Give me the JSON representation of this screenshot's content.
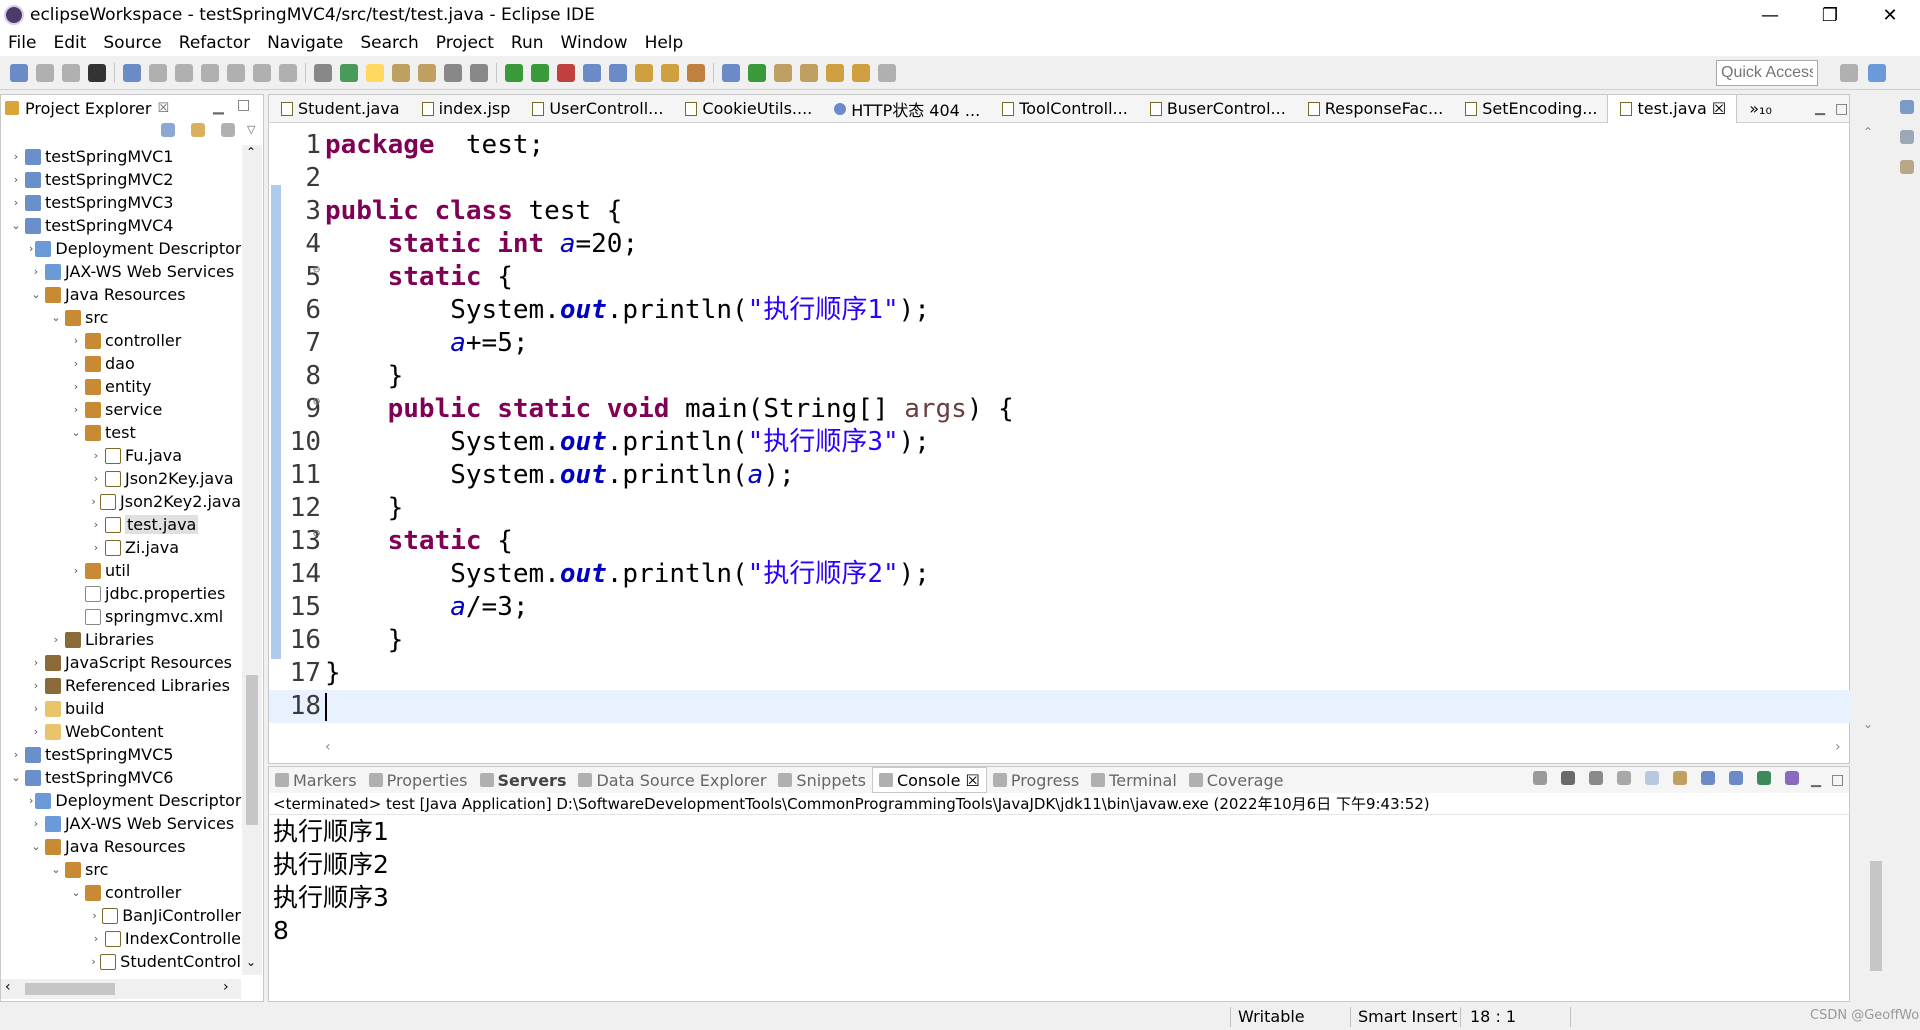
{
  "window": {
    "title": "eclipseWorkspace - testSpringMVC4/src/test/test.java - Eclipse IDE",
    "minimize": "—",
    "restore": "❐",
    "close": "✕"
  },
  "menu": [
    "File",
    "Edit",
    "Source",
    "Refactor",
    "Navigate",
    "Search",
    "Project",
    "Run",
    "Window",
    "Help"
  ],
  "quick_access": {
    "placeholder": "Quick Access"
  },
  "project_explorer": {
    "title": "Project Explorer",
    "close": "☒",
    "tree": [
      {
        "label": "testSpringMVC1",
        "arrow": "›",
        "icon": "project",
        "indent": 0
      },
      {
        "label": "testSpringMVC2",
        "arrow": "›",
        "icon": "project",
        "indent": 0
      },
      {
        "label": "testSpringMVC3",
        "arrow": "›",
        "icon": "project",
        "indent": 0
      },
      {
        "label": "testSpringMVC4",
        "arrow": "⌄",
        "icon": "project",
        "indent": 0
      },
      {
        "label": "Deployment Descriptor",
        "arrow": "›",
        "icon": "web",
        "indent": 1
      },
      {
        "label": "JAX-WS Web Services",
        "arrow": "›",
        "icon": "web",
        "indent": 1
      },
      {
        "label": "Java Resources",
        "arrow": "⌄",
        "icon": "pkg",
        "indent": 1
      },
      {
        "label": "src",
        "arrow": "⌄",
        "icon": "pkg",
        "indent": 2
      },
      {
        "label": "controller",
        "arrow": "›",
        "icon": "pkg",
        "indent": 3
      },
      {
        "label": "dao",
        "arrow": "›",
        "icon": "pkg",
        "indent": 3
      },
      {
        "label": "entity",
        "arrow": "›",
        "icon": "pkg",
        "indent": 3
      },
      {
        "label": "service",
        "arrow": "›",
        "icon": "pkg",
        "indent": 3
      },
      {
        "label": "test",
        "arrow": "⌄",
        "icon": "pkg",
        "indent": 3
      },
      {
        "label": "Fu.java",
        "arrow": "›",
        "icon": "java",
        "indent": 4
      },
      {
        "label": "Json2Key.java",
        "arrow": "›",
        "icon": "java",
        "indent": 4
      },
      {
        "label": "Json2Key2.java",
        "arrow": "›",
        "icon": "java",
        "indent": 4
      },
      {
        "label": "test.java",
        "arrow": "›",
        "icon": "java",
        "indent": 4,
        "selected": true
      },
      {
        "label": "Zi.java",
        "arrow": "›",
        "icon": "java",
        "indent": 4
      },
      {
        "label": "util",
        "arrow": "›",
        "icon": "pkg",
        "indent": 3
      },
      {
        "label": "jdbc.properties",
        "arrow": "",
        "icon": "file",
        "indent": 3
      },
      {
        "label": "springmvc.xml",
        "arrow": "",
        "icon": "file",
        "indent": 3
      },
      {
        "label": "Libraries",
        "arrow": "›",
        "icon": "lib",
        "indent": 2
      },
      {
        "label": "JavaScript Resources",
        "arrow": "›",
        "icon": "lib",
        "indent": 1
      },
      {
        "label": "Referenced Libraries",
        "arrow": "›",
        "icon": "lib",
        "indent": 1
      },
      {
        "label": "build",
        "arrow": "›",
        "icon": "folder",
        "indent": 1
      },
      {
        "label": "WebContent",
        "arrow": "›",
        "icon": "folder",
        "indent": 1
      },
      {
        "label": "testSpringMVC5",
        "arrow": "›",
        "icon": "project",
        "indent": 0
      },
      {
        "label": "testSpringMVC6",
        "arrow": "⌄",
        "icon": "project",
        "indent": 0
      },
      {
        "label": "Deployment Descriptor",
        "arrow": "›",
        "icon": "web",
        "indent": 1
      },
      {
        "label": "JAX-WS Web Services",
        "arrow": "›",
        "icon": "web",
        "indent": 1
      },
      {
        "label": "Java Resources",
        "arrow": "⌄",
        "icon": "pkg",
        "indent": 1
      },
      {
        "label": "src",
        "arrow": "⌄",
        "icon": "pkg",
        "indent": 2
      },
      {
        "label": "controller",
        "arrow": "⌄",
        "icon": "pkg",
        "indent": 3
      },
      {
        "label": "BanJiController",
        "arrow": "›",
        "icon": "java",
        "indent": 4
      },
      {
        "label": "IndexControlle",
        "arrow": "›",
        "icon": "java",
        "indent": 4
      },
      {
        "label": "StudentControl",
        "arrow": "›",
        "icon": "java",
        "indent": 4
      }
    ]
  },
  "editor": {
    "tabs": [
      {
        "label": "Student.java",
        "icon": "java"
      },
      {
        "label": "index.jsp",
        "icon": "file"
      },
      {
        "label": "UserControll...",
        "icon": "java"
      },
      {
        "label": "CookieUtils....",
        "icon": "java"
      },
      {
        "label": "HTTP状态 404 ...",
        "icon": "web"
      },
      {
        "label": "ToolControll...",
        "icon": "java"
      },
      {
        "label": "BuserControl...",
        "icon": "java"
      },
      {
        "label": "ResponseFac...",
        "icon": "java"
      },
      {
        "label": "SetEncoding...",
        "icon": "java"
      },
      {
        "label": "test.java ☒",
        "icon": "java",
        "active": true
      },
      {
        "label": "»₁₀",
        "icon": ""
      }
    ],
    "lines": [
      {
        "n": "1",
        "fold": "",
        "parts": [
          [
            "kw",
            "package"
          ],
          [
            "",
            "  test;"
          ]
        ]
      },
      {
        "n": "2",
        "fold": "",
        "parts": []
      },
      {
        "n": "3",
        "fold": "",
        "parts": [
          [
            "kw",
            "public"
          ],
          [
            "",
            " "
          ],
          [
            "kw",
            "class"
          ],
          [
            "",
            " test {"
          ]
        ]
      },
      {
        "n": "4",
        "fold": "",
        "parts": [
          [
            "",
            "    "
          ],
          [
            "kw",
            "static"
          ],
          [
            "",
            " "
          ],
          [
            "kw",
            "int"
          ],
          [
            "",
            " "
          ],
          [
            "fi",
            "a"
          ],
          [
            "",
            "=20;"
          ]
        ]
      },
      {
        "n": "5",
        "fold": "⊖",
        "parts": [
          [
            "",
            "    "
          ],
          [
            "kw",
            "static"
          ],
          [
            "",
            " {"
          ]
        ]
      },
      {
        "n": "6",
        "fold": "",
        "parts": [
          [
            "",
            "        System."
          ],
          [
            "fib",
            "out"
          ],
          [
            "",
            ".println("
          ],
          [
            "st",
            "\"执行顺序1\""
          ],
          [
            "",
            ");"
          ]
        ]
      },
      {
        "n": "7",
        "fold": "",
        "parts": [
          [
            "",
            "        "
          ],
          [
            "fi",
            "a"
          ],
          [
            "",
            "+=5;"
          ]
        ]
      },
      {
        "n": "8",
        "fold": "",
        "parts": [
          [
            "",
            "    }"
          ]
        ]
      },
      {
        "n": "9",
        "fold": "⊖",
        "parts": [
          [
            "",
            "    "
          ],
          [
            "kw",
            "public"
          ],
          [
            "",
            " "
          ],
          [
            "kw",
            "static"
          ],
          [
            "",
            " "
          ],
          [
            "kw",
            "void"
          ],
          [
            "",
            " main(String[] "
          ],
          [
            "pm",
            "args"
          ],
          [
            "",
            ") {"
          ]
        ]
      },
      {
        "n": "10",
        "fold": "",
        "parts": [
          [
            "",
            "        System."
          ],
          [
            "fib",
            "out"
          ],
          [
            "",
            ".println("
          ],
          [
            "st",
            "\"执行顺序3\""
          ],
          [
            "",
            ");"
          ]
        ]
      },
      {
        "n": "11",
        "fold": "",
        "parts": [
          [
            "",
            "        System."
          ],
          [
            "fib",
            "out"
          ],
          [
            "",
            ".println("
          ],
          [
            "fi",
            "a"
          ],
          [
            "",
            ");"
          ]
        ]
      },
      {
        "n": "12",
        "fold": "",
        "parts": [
          [
            "",
            "    }"
          ]
        ]
      },
      {
        "n": "13",
        "fold": "⊖",
        "parts": [
          [
            "",
            "    "
          ],
          [
            "kw",
            "static"
          ],
          [
            "",
            " {"
          ]
        ]
      },
      {
        "n": "14",
        "fold": "",
        "parts": [
          [
            "",
            "        System."
          ],
          [
            "fib",
            "out"
          ],
          [
            "",
            ".println("
          ],
          [
            "st",
            "\"执行顺序2\""
          ],
          [
            "",
            ");"
          ]
        ]
      },
      {
        "n": "15",
        "fold": "",
        "parts": [
          [
            "",
            "        "
          ],
          [
            "fi",
            "a"
          ],
          [
            "",
            "/=3;"
          ]
        ]
      },
      {
        "n": "16",
        "fold": "",
        "parts": [
          [
            "",
            "    }"
          ]
        ]
      },
      {
        "n": "17",
        "fold": "",
        "parts": [
          [
            "",
            "}"
          ]
        ]
      },
      {
        "n": "18",
        "fold": "",
        "parts": [],
        "current": true
      }
    ]
  },
  "console": {
    "tabs": [
      {
        "label": "Markers",
        "style": ""
      },
      {
        "label": "Properties",
        "style": ""
      },
      {
        "label": "Servers",
        "style": "bold"
      },
      {
        "label": "Data Source Explorer",
        "style": ""
      },
      {
        "label": "Snippets",
        "style": ""
      },
      {
        "label": "Console ☒",
        "style": "active"
      },
      {
        "label": "Progress",
        "style": ""
      },
      {
        "label": "Terminal",
        "style": ""
      },
      {
        "label": "Coverage",
        "style": ""
      }
    ],
    "terminated": "<terminated> test [Java Application] D:\\SoftwareDevelopmentTools\\CommonProgrammingTools\\JavaJDK\\jdk11\\bin\\javaw.exe (2022年10月6日 下午9:43:52)",
    "output": [
      "执行顺序1",
      "执行顺序2",
      "执行顺序3",
      "8"
    ]
  },
  "status": {
    "writable": "Writable",
    "insert": "Smart Insert",
    "position": "18 : 1",
    "watermark": "CSDN @GeoffWo"
  },
  "colors": {
    "keyword": "#7f0055",
    "string": "#2a00ff",
    "field": "#0000c0",
    "current_line": "#e8f2fe"
  }
}
